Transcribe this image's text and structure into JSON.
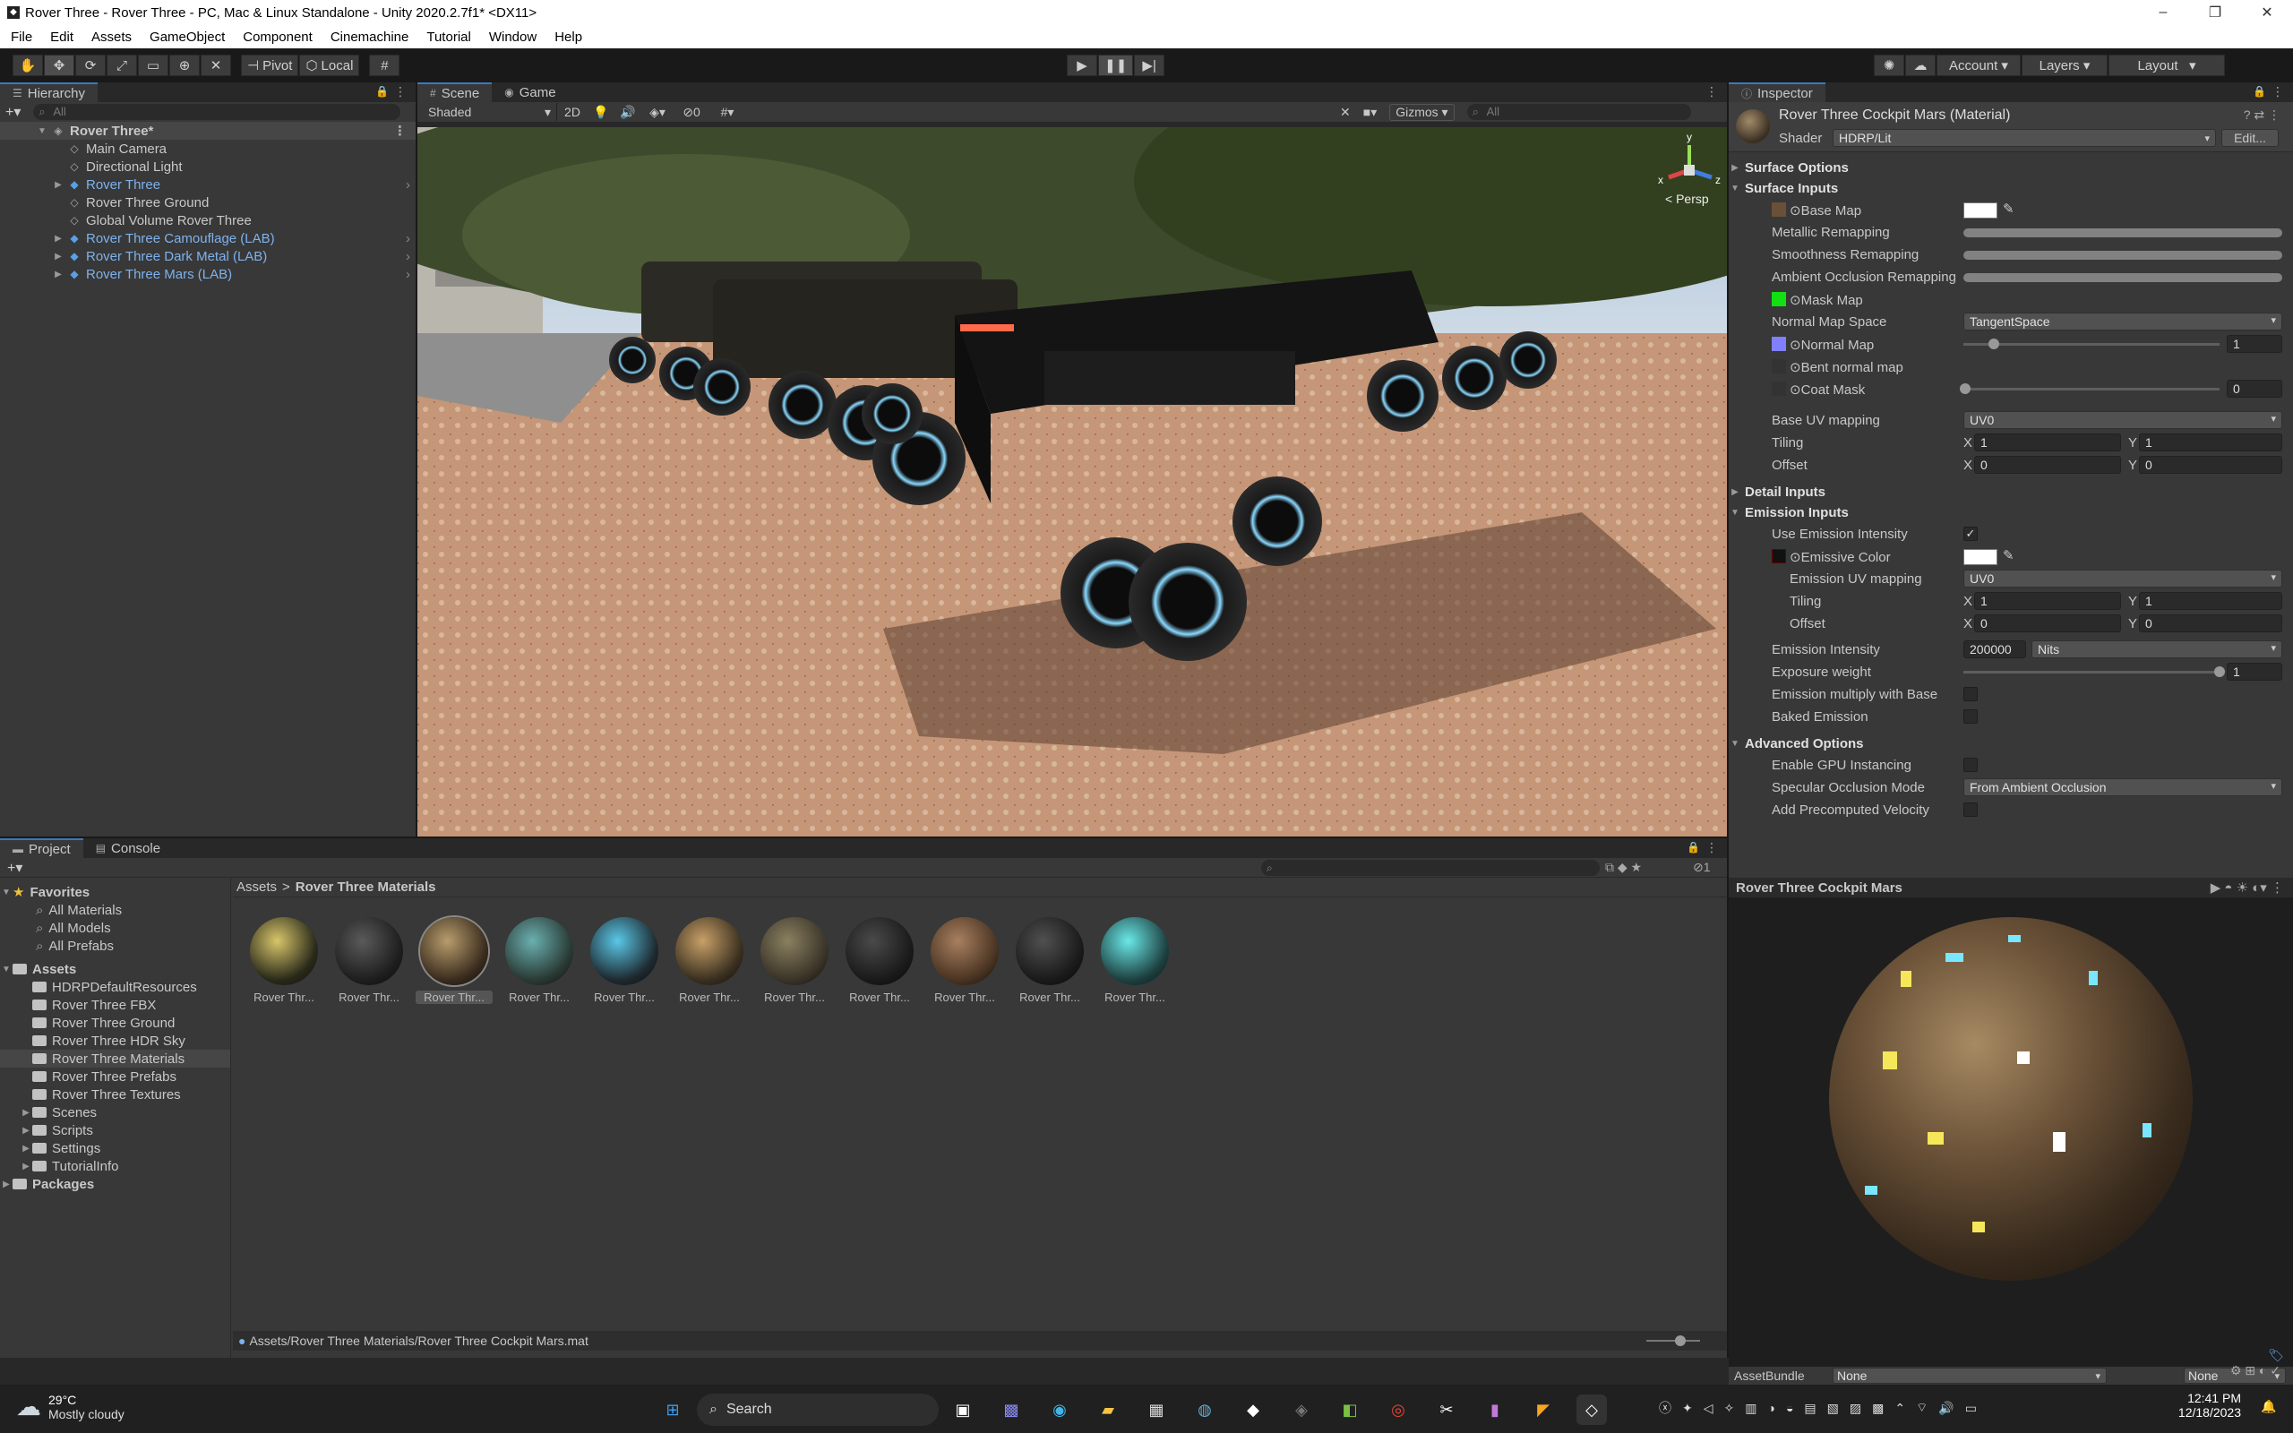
{
  "window": {
    "title": "Rover Three - Rover Three - PC, Mac & Linux Standalone - Unity 2020.2.7f1* <DX11>",
    "min": "–",
    "max": "❐",
    "close": "✕"
  },
  "menu": [
    "File",
    "Edit",
    "Assets",
    "GameObject",
    "Component",
    "Cinemachine",
    "Tutorial",
    "Window",
    "Help"
  ],
  "toolbar": {
    "pivot": "Pivot",
    "local": "Local",
    "account": "Account",
    "layers": "Layers",
    "layout": "Layout"
  },
  "hierarchy": {
    "tab": "Hierarchy",
    "search_placeholder": "All",
    "scene": "Rover Three*",
    "items": [
      {
        "label": "Main Camera",
        "prefab": false,
        "expandable": false
      },
      {
        "label": "Directional Light",
        "prefab": false,
        "expandable": false
      },
      {
        "label": "Rover Three",
        "prefab": true,
        "expandable": true
      },
      {
        "label": "Rover Three Ground",
        "prefab": false,
        "expandable": false
      },
      {
        "label": "Global Volume Rover Three",
        "prefab": false,
        "expandable": false
      },
      {
        "label": "Rover Three Camouflage (LAB)",
        "prefab": true,
        "expandable": true
      },
      {
        "label": "Rover Three Dark Metal (LAB)",
        "prefab": true,
        "expandable": true
      },
      {
        "label": "Rover Three Mars (LAB)",
        "prefab": true,
        "expandable": true
      }
    ]
  },
  "scene": {
    "tab_scene": "Scene",
    "tab_game": "Game",
    "shading": "Shaded",
    "mode_2d": "2D",
    "hidden_count": "0",
    "gizmos": "Gizmos",
    "search_placeholder": "All",
    "persp": "< Persp",
    "axis_x": "x",
    "axis_y": "y",
    "axis_z": "z"
  },
  "inspector": {
    "tab": "Inspector",
    "material": "Rover Three Cockpit Mars (Material)",
    "shader_label": "Shader",
    "shader": "HDRP/Lit",
    "edit": "Edit...",
    "surface_options": "Surface Options",
    "surface_inputs": "Surface Inputs",
    "base_map": "Base Map",
    "metallic": "Metallic Remapping",
    "smoothness": "Smoothness Remapping",
    "ao": "Ambient Occlusion Remapping",
    "mask_map": "Mask Map",
    "normal_space_label": "Normal Map Space",
    "normal_space": "TangentSpace",
    "normal_map": "Normal Map",
    "normal_value": "1",
    "bent_normal": "Bent normal map",
    "coat_mask": "Coat Mask",
    "coat_value": "0",
    "base_uv_label": "Base UV mapping",
    "base_uv": "UV0",
    "tiling": "Tiling",
    "offset": "Offset",
    "x": "X",
    "y": "Y",
    "one": "1",
    "zero": "0",
    "detail_inputs": "Detail Inputs",
    "emission_inputs": "Emission Inputs",
    "use_emission_intensity": "Use Emission Intensity",
    "emissive_color": "Emissive Color",
    "emission_uv_label": "Emission UV mapping",
    "emission_uv": "UV0",
    "emission_intensity_label": "Emission Intensity",
    "emission_intensity": "200000",
    "nits": "Nits",
    "exposure_weight": "Exposure weight",
    "exposure_value": "1",
    "emission_multiply": "Emission multiply with Base",
    "baked_emission": "Baked Emission",
    "advanced_options": "Advanced Options",
    "gpu_instancing": "Enable GPU Instancing",
    "specular_occlusion_label": "Specular Occlusion Mode",
    "specular_occlusion": "From Ambient Occlusion",
    "precomputed_velocity": "Add Precomputed Velocity",
    "preview_title": "Rover Three Cockpit Mars",
    "assetbundle_label": "AssetBundle",
    "assetbundle": "None",
    "variant": "None"
  },
  "project": {
    "tab_project": "Project",
    "tab_console": "Console",
    "favorites": "Favorites",
    "fav_items": [
      "All Materials",
      "All Models",
      "All Prefabs"
    ],
    "assets": "Assets",
    "folders": [
      "HDRPDefaultResources",
      "Rover Three FBX",
      "Rover Three Ground",
      "Rover Three HDR Sky",
      "Rover Three Materials",
      "Rover Three Prefabs",
      "Rover Three Textures",
      "Scenes",
      "Scripts",
      "Settings",
      "TutorialInfo"
    ],
    "expandable_folders": [
      "Scenes",
      "Scripts",
      "Settings",
      "TutorialInfo"
    ],
    "selected_folder": "Rover Three Materials",
    "packages": "Packages",
    "breadcrumb_root": "Assets",
    "breadcrumb_sep": ">",
    "breadcrumb_current": "Rover Three Materials",
    "asset_label": "Rover Thr...",
    "asset_count": 11,
    "badge": "1",
    "status_path": "Assets/Rover Three Materials/Rover Three Cockpit Mars.mat"
  },
  "taskbar": {
    "temp": "29°C",
    "weather": "Mostly cloudy",
    "search": "Search",
    "time": "12:41 PM",
    "date": "12/18/2023"
  }
}
